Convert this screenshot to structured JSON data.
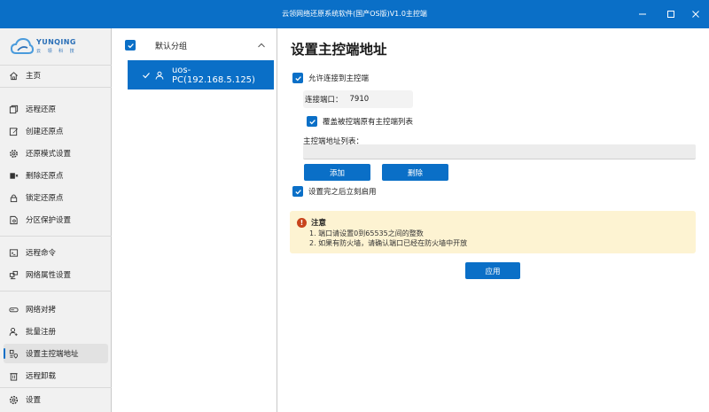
{
  "window": {
    "title": "云领网络还原系统软件(国产OS版)V1.0主控端"
  },
  "logo": {
    "brand": "YUNQING",
    "brand_sub": "云 领 科 技"
  },
  "sidebar": {
    "items": [
      {
        "label": "主页",
        "icon": "home-icon"
      },
      {
        "label": "远程还原",
        "icon": "copy-icon"
      },
      {
        "label": "创建还原点",
        "icon": "edit-icon"
      },
      {
        "label": "还原模式设置",
        "icon": "gear-icon"
      },
      {
        "label": "删除还原点",
        "icon": "delete-icon"
      },
      {
        "label": "锁定还原点",
        "icon": "lock-icon"
      },
      {
        "label": "分区保护设置",
        "icon": "shield-doc-icon"
      },
      {
        "label": "远程命令",
        "icon": "terminal-icon"
      },
      {
        "label": "网络属性设置",
        "icon": "network-icon"
      },
      {
        "label": "网络对拷",
        "icon": "drive-icon"
      },
      {
        "label": "批量注册",
        "icon": "user-add-icon"
      },
      {
        "label": "设置主控端地址",
        "icon": "address-icon"
      },
      {
        "label": "远程卸载",
        "icon": "trash-icon"
      },
      {
        "label": "设置",
        "icon": "settings-icon"
      }
    ],
    "active_index": 11
  },
  "groups": {
    "group_name": "默认分组",
    "devices": [
      {
        "name": "uos-PC(192.168.5.125)",
        "selected": true
      }
    ]
  },
  "main": {
    "page_title": "设置主控端地址",
    "allow_connect_label": "允许连接到主控端",
    "allow_connect_checked": true,
    "port_label": "连接端口：",
    "port_value": "7910",
    "overwrite_label": "覆盖被控端原有主控端列表",
    "overwrite_checked": true,
    "address_list_label": "主控端地址列表：",
    "add_button": "添加",
    "delete_button": "删除",
    "apply_immediately_label": "设置完之后立刻启用",
    "apply_immediately_checked": true,
    "notice": {
      "title": "注意",
      "lines": [
        "1. 端口请设置0到65535之间的整数",
        "2. 如果有防火墙，请确认端口已经在防火墙中开放"
      ]
    },
    "apply_button": "应用"
  },
  "colors": {
    "accent": "#0a6fc7",
    "sidebar_bg": "#f1f1f1",
    "notice_bg": "#fdf3d2",
    "warning": "#c8431c"
  }
}
